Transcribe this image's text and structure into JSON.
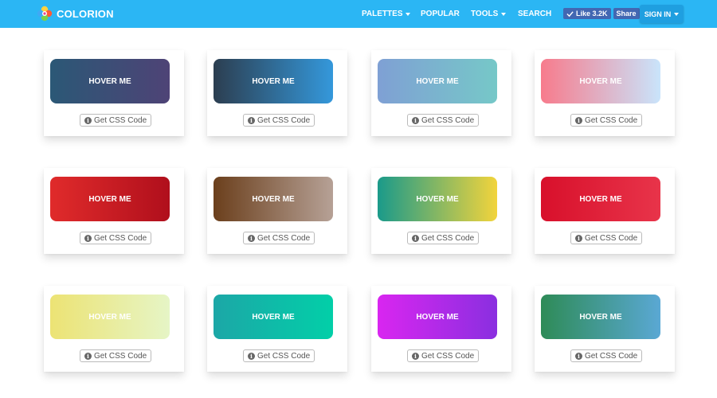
{
  "brand": {
    "name": "COLORION"
  },
  "nav": {
    "palettes": "PALETTES",
    "popular": "POPULAR",
    "tools": "TOOLS",
    "search": "SEARCH",
    "like_label": "Like 3.2K",
    "share_label": "Share",
    "signin": "SIGN IN"
  },
  "colors": {
    "topbar": "#2bb6f4",
    "signin": "#1f9fe0",
    "facebook": "#4267b2"
  },
  "cards": [
    {
      "button": "HOVER ME",
      "css_label": "Get CSS Code",
      "gradient": [
        "#2b5876",
        "#4e4376"
      ]
    },
    {
      "button": "HOVER ME",
      "css_label": "Get CSS Code",
      "gradient": [
        "#2c3e50",
        "#3498db"
      ]
    },
    {
      "button": "HOVER ME",
      "css_label": "Get CSS Code",
      "gradient": [
        "#7fa0d4",
        "#76c8c8"
      ]
    },
    {
      "button": "HOVER ME",
      "css_label": "Get CSS Code",
      "gradient": [
        "#f77b8c",
        "#c9e4fb"
      ]
    },
    {
      "button": "HOVER ME",
      "css_label": "Get CSS Code",
      "gradient": [
        "#e02b2b",
        "#b00f1c"
      ]
    },
    {
      "button": "HOVER ME",
      "css_label": "Get CSS Code",
      "gradient": [
        "#6b3f1c",
        "#b6a196"
      ]
    },
    {
      "button": "HOVER ME",
      "css_label": "Get CSS Code",
      "gradient": [
        "#1a9a8a",
        "#f2d43c"
      ]
    },
    {
      "button": "HOVER ME",
      "css_label": "Get CSS Code",
      "gradient": [
        "#d8102b",
        "#e8344a"
      ]
    },
    {
      "button": "HOVER ME",
      "css_label": "Get CSS Code",
      "gradient": [
        "#ece374",
        "#e6f5c6"
      ]
    },
    {
      "button": "HOVER ME",
      "css_label": "Get CSS Code",
      "gradient": [
        "#1ca7a7",
        "#02cfa8"
      ]
    },
    {
      "button": "HOVER ME",
      "css_label": "Get CSS Code",
      "gradient": [
        "#d926f0",
        "#8a2fe0"
      ]
    },
    {
      "button": "HOVER ME",
      "css_label": "Get CSS Code",
      "gradient": [
        "#2e8b57",
        "#5aa8d4"
      ]
    }
  ]
}
